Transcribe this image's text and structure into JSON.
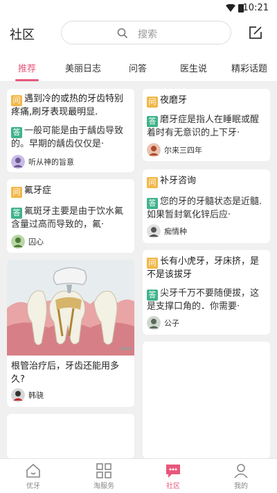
{
  "status": {
    "time": "10:21"
  },
  "header": {
    "title": "社区",
    "search_placeholder": "搜索"
  },
  "tabs": [
    {
      "label": "推荐"
    },
    {
      "label": "美丽日志"
    },
    {
      "label": "问答"
    },
    {
      "label": "医生说"
    },
    {
      "label": "精彩话题"
    }
  ],
  "badges": {
    "question": "问",
    "answer": "答"
  },
  "cards_left": [
    {
      "question": "遇到冷的或热的牙齿特别疼痛,刷牙表现最明显.",
      "answer": "一般可能是由于龋齿导致的。早期的龋齿仅仅是·",
      "user": "听从神的旨意"
    },
    {
      "question": "氟牙症",
      "answer": "氟斑牙主要是由于饮水氟含量过高而导致的，氟·",
      "user": "囚心"
    },
    {
      "caption": "根管治疗后，牙齿还能用多久?",
      "user": "韩骁"
    }
  ],
  "cards_right": [
    {
      "question": "夜磨牙",
      "answer": "磨牙症是指人在睡眠或醒着时有无意识的上下牙·",
      "user": "尔来三四年"
    },
    {
      "question": "补牙咨询",
      "answer": "您的牙的牙髓状态是近髓.如果暂封氧化锌后应·",
      "user": "痴情种"
    },
    {
      "question": "长有小虎牙，牙床挤，是不是该拔牙",
      "answer": "尖牙千万不要随便拔，这是支撑口角的．你需要·",
      "user": "公子"
    }
  ],
  "bottom_nav": [
    {
      "label": "优牙",
      "icon": "home-icon"
    },
    {
      "label": "淘服务",
      "icon": "grid-icon"
    },
    {
      "label": "社区",
      "icon": "chat-icon"
    },
    {
      "label": "我的",
      "icon": "person-icon"
    }
  ],
  "colors": {
    "accent": "#e8577c",
    "question_badge": "#f2b84b",
    "answer_badge": "#3fb38a"
  }
}
